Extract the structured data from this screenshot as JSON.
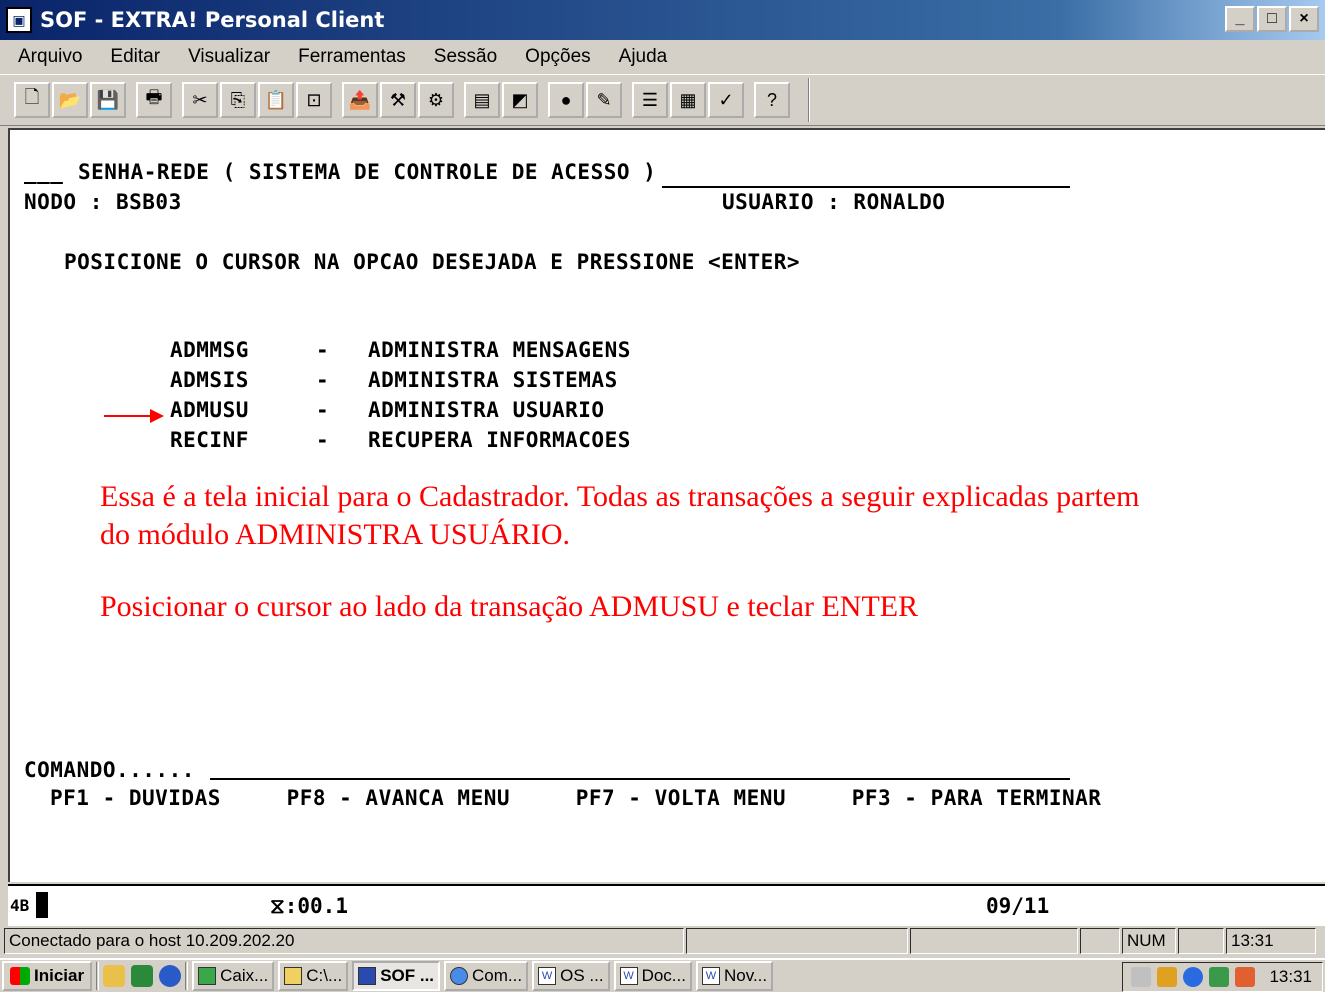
{
  "window": {
    "title": "SOF - EXTRA! Personal Client",
    "min": "_",
    "max": "□",
    "close": "×"
  },
  "menu": [
    "Arquivo",
    "Editar",
    "Visualizar",
    "Ferramentas",
    "Sessão",
    "Opções",
    "Ajuda"
  ],
  "toolbar": {
    "groups": [
      [
        "new-icon",
        "open-icon",
        "save-icon"
      ],
      [
        "print-icon"
      ],
      [
        "cut-icon",
        "copy-icon",
        "paste-icon",
        "quick-pad-icon"
      ],
      [
        "send-file-icon",
        "tools-icon",
        "macro-icon"
      ],
      [
        "edit-scheme-icon",
        "hotspot-icon"
      ],
      [
        "record-icon",
        "clear-icon"
      ],
      [
        "settings-a-icon",
        "settings-b-icon",
        "settings-c-icon"
      ],
      [
        "help-icon"
      ]
    ]
  },
  "terminal": {
    "header_prefix": "___",
    "header": "SENHA-REDE ( SISTEMA DE CONTROLE DE ACESSO )",
    "nodo": "NODO : BSB03",
    "usuario": "USUARIO : RONALDO",
    "instruction": "POSICIONE O CURSOR NA OPCAO DESEJADA E PRESSIONE <ENTER>",
    "options": [
      {
        "code": "ADMMSG",
        "sep": "-",
        "desc": "ADMINISTRA MENSAGENS"
      },
      {
        "code": "ADMSIS",
        "sep": "-",
        "desc": "ADMINISTRA SISTEMAS"
      },
      {
        "code": "ADMUSU",
        "sep": "-",
        "desc": "ADMINISTRA USUARIO"
      },
      {
        "code": "RECINF",
        "sep": "-",
        "desc": "RECUPERA INFORMACOES"
      }
    ],
    "annotation_1a": "Essa é a tela inicial para o Cadastrador. Todas as transações a seguir explicadas partem",
    "annotation_1b": "do módulo ADMINISTRA USUÁRIO.",
    "annotation_2": "Posicionar o cursor ao lado da transação ADMUSU e teclar ENTER",
    "comando": "COMANDO......",
    "pfkeys": "PF1 - DUVIDAS     PF8 - AVANCA MENU     PF7 - VOLTA MENU     PF3 - PARA TERMINAR"
  },
  "oia": {
    "session": "4B",
    "timer": "⧖:00.1",
    "cursor_pos": "09/11"
  },
  "statusbar": {
    "connection": "Conectado para o host 10.209.202.20",
    "num": "NUM",
    "time": "13:31"
  },
  "taskbar": {
    "start": "Iniciar",
    "tasks": [
      {
        "label": "Caix...",
        "icon": "outlook-icon",
        "active": false
      },
      {
        "label": "C:\\...",
        "icon": "folder-icon",
        "active": false
      },
      {
        "label": "SOF ...",
        "icon": "terminal-icon",
        "active": true
      },
      {
        "label": "Com...",
        "icon": "ie-icon",
        "active": false
      },
      {
        "label": "OS ...",
        "icon": "word-icon",
        "active": false
      },
      {
        "label": "Doc...",
        "icon": "word-icon",
        "active": false
      },
      {
        "label": "Nov...",
        "icon": "word-icon",
        "active": false
      }
    ],
    "clock": "13:31"
  },
  "colors": {
    "annotation": "#ff0000",
    "titlebar": "#0a246a"
  }
}
